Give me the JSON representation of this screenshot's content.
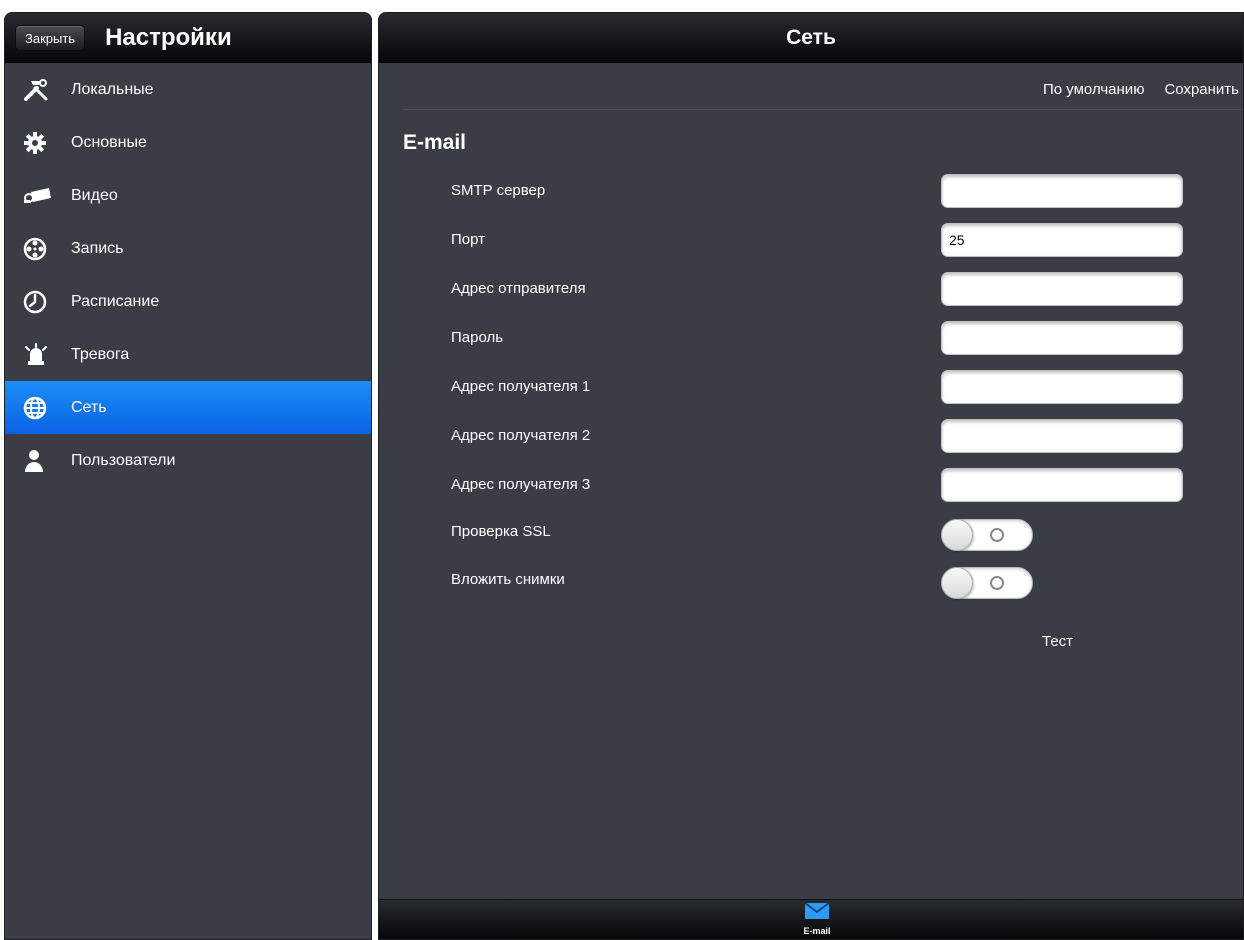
{
  "left": {
    "close_label": "Закрыть",
    "title": "Настройки",
    "items": [
      {
        "label": "Локальные",
        "icon": "tools-icon",
        "active": false
      },
      {
        "label": "Основные",
        "icon": "gear-icon",
        "active": false
      },
      {
        "label": "Видео",
        "icon": "camera-icon",
        "active": false
      },
      {
        "label": "Запись",
        "icon": "film-reel-icon",
        "active": false
      },
      {
        "label": "Расписание",
        "icon": "clock-icon",
        "active": false
      },
      {
        "label": "Тревога",
        "icon": "alarm-siren-icon",
        "active": false
      },
      {
        "label": "Сеть",
        "icon": "globe-icon",
        "active": true
      },
      {
        "label": "Пользователи",
        "icon": "user-icon",
        "active": false
      }
    ]
  },
  "right": {
    "title": "Сеть",
    "default_label": "По умолчанию",
    "save_label": "Сохранить",
    "section_title": "E-mail",
    "fields": [
      {
        "label": "SMTP сервер",
        "value": ""
      },
      {
        "label": "Порт",
        "value": "25"
      },
      {
        "label": "Адрес отправителя",
        "value": ""
      },
      {
        "label": "Пароль",
        "value": ""
      },
      {
        "label": "Адрес получателя 1",
        "value": ""
      },
      {
        "label": "Адрес получателя 2",
        "value": ""
      },
      {
        "label": "Адрес получателя 3",
        "value": ""
      }
    ],
    "toggles": [
      {
        "label": "Проверка SSL",
        "on": false
      },
      {
        "label": "Вложить снимки",
        "on": false
      }
    ],
    "test_label": "Тест",
    "tab_label": "E-mail",
    "tab_icon": "envelope-icon"
  },
  "colors": {
    "panel_bg": "#3b3d45",
    "active_item": "#0a62e4",
    "tab_icon": "#2d9cf5"
  }
}
